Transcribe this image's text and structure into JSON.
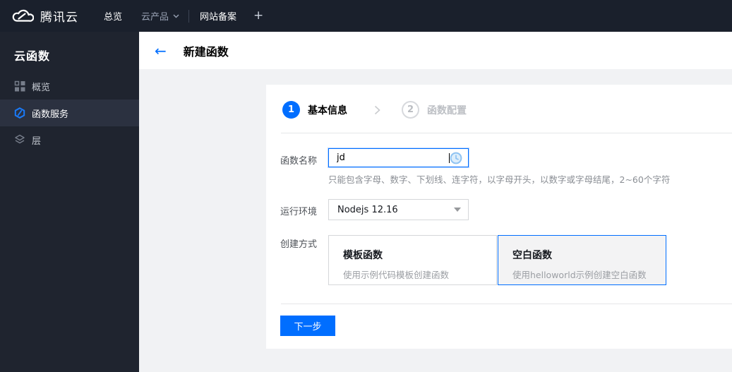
{
  "topnav": {
    "brand": "腾讯云",
    "overview_label": "总览",
    "products_label": "云产品",
    "beian_label": "网站备案",
    "add_tab_label": "+"
  },
  "sidebar": {
    "title": "云函数",
    "items": [
      {
        "label": "概览",
        "icon": "grid-icon",
        "selected": false
      },
      {
        "label": "函数服务",
        "icon": "scf-icon",
        "selected": true
      },
      {
        "label": "层",
        "icon": "layers-icon",
        "selected": false
      }
    ]
  },
  "header": {
    "title": "新建函数"
  },
  "wizard": {
    "steps": [
      {
        "number": "1",
        "label": "基本信息",
        "active": true
      },
      {
        "number": "2",
        "label": "函数配置",
        "active": false
      }
    ]
  },
  "form": {
    "fields": {
      "name": {
        "label": "函数名称",
        "value": "jd",
        "hint": "只能包含字母、数字、下划线、连字符，以字母开头，以数字或字母结尾，2~60个字符",
        "status_icon": "clock-pending-icon"
      },
      "runtime": {
        "label": "运行环境",
        "value": "Nodejs 12.16"
      },
      "method": {
        "label": "创建方式",
        "options": [
          {
            "title": "模板函数",
            "desc": "使用示例代码模板创建函数",
            "selected": false
          },
          {
            "title": "空白函数",
            "desc": "使用helloworld示例创建空白函数",
            "selected": true
          }
        ]
      }
    },
    "next_button": "下一步"
  },
  "colors": {
    "accent_blue": "#006eff",
    "topnav_bg": "#1a202c",
    "sidebar_bg": "#1f242f",
    "sidebar_selected_bg": "#2b3140",
    "content_bg": "#f1f2f4",
    "selected_card_bg": "#f3f3f4"
  }
}
